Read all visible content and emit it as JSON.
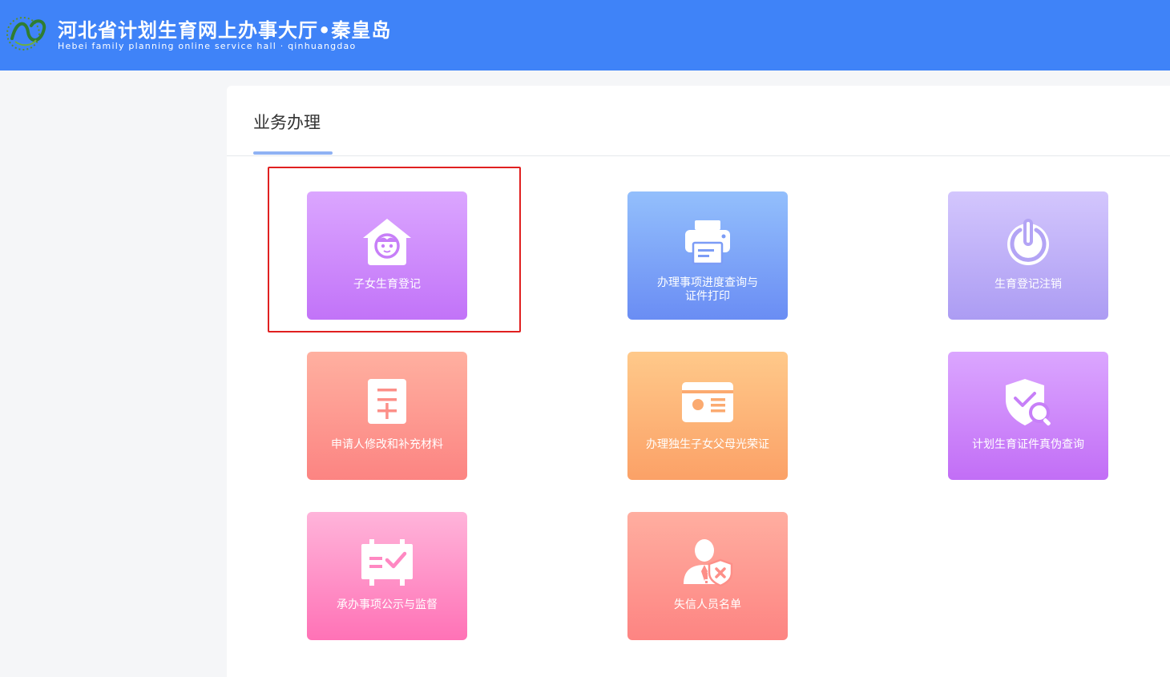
{
  "header": {
    "title": "河北省计划生育网上办事大厅•秦皇岛",
    "subtitle": "Hebei family planning online service hall · qinhuangdao",
    "background_color": "#3f83f8"
  },
  "section": {
    "tab_label": "业务办理"
  },
  "services": [
    {
      "label": "子女生育登记",
      "icon": "house-child-icon",
      "highlighted": true
    },
    {
      "label_line1": "办理事项进度查询与",
      "label_line2": "证件打印",
      "icon": "printer-icon"
    },
    {
      "label": "生育登记注销",
      "icon": "power-icon"
    },
    {
      "label": "申请人修改和补充材料",
      "icon": "document-add-icon"
    },
    {
      "label": "办理独生子女父母光荣证",
      "icon": "id-card-icon"
    },
    {
      "label": "计划生育证件真伪查询",
      "icon": "shield-search-icon"
    },
    {
      "label": "承办事项公示与监督",
      "icon": "notice-board-icon"
    },
    {
      "label": "失信人员名单",
      "icon": "user-blacklist-icon"
    }
  ],
  "colors": {
    "highlight_border": "#e02020",
    "tab_underline": "#8fb2f4"
  }
}
